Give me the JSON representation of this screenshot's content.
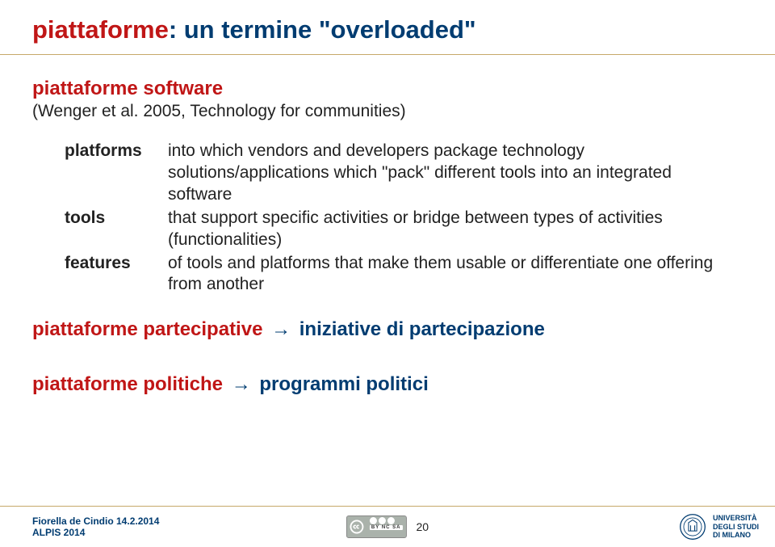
{
  "title": {
    "word1": "piattaforme",
    "rest": ": un termine \"overloaded\""
  },
  "section1": {
    "heading": "piattaforme software",
    "citation": "(Wenger et al. 2005, Technology for communities)"
  },
  "definitions": [
    {
      "term": "platforms",
      "desc": "into which vendors and developers package technology solutions/applications which \"pack\" different tools into an integrated software"
    },
    {
      "term": "tools",
      "desc": "that support specific activities or bridge between types of activities (functionalities)"
    },
    {
      "term": "features",
      "desc": "of tools and platforms that make them usable or differentiate one offering from another"
    }
  ],
  "line2": {
    "left": "piattaforme partecipative",
    "arrow": "→",
    "right": "iniziative di partecipazione"
  },
  "line3": {
    "left": "piattaforme politiche",
    "arrow": "→",
    "right": "programmi politici"
  },
  "footer": {
    "author": "Fiorella de Cindio 14.2.2014",
    "event": "ALPIS 2014",
    "cc_label": "BY NC SA",
    "page_number": "20",
    "uni_line1": "UNIVERSITÀ",
    "uni_line2": "DEGLI STUDI",
    "uni_line3": "DI MILANO"
  }
}
